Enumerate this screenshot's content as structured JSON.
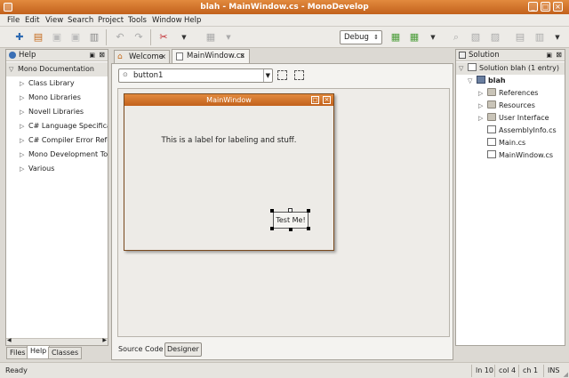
{
  "window": {
    "title": "blah - MainWindow.cs - MonoDevelop"
  },
  "menu": [
    "File",
    "Edit",
    "View",
    "Search",
    "Project",
    "Tools",
    "Window",
    "Help"
  ],
  "toolbar": {
    "config": "Debug"
  },
  "help_panel": {
    "title": "Help",
    "root": "Mono Documentation",
    "items": [
      "Class Library",
      "Mono Libraries",
      "Novell Libraries",
      "C# Language Specifica",
      "C# Compiler Error Refe",
      "Mono Development Too",
      "Various"
    ],
    "tabs": [
      "Files",
      "Help",
      "Classes"
    ]
  },
  "doc_tabs": [
    "Welcome",
    "MainWindow.cs"
  ],
  "designer": {
    "widget_select": "button1",
    "form_title": "MainWindow",
    "label_text": "This is a label for labeling and stuff.",
    "button_text": "Test Me!",
    "view_tabs": [
      "Source Code",
      "Designer"
    ]
  },
  "solution_panel": {
    "title": "Solution",
    "root": "Solution blah (1 entry)",
    "project": "blah",
    "items": [
      {
        "label": "References",
        "kind": "folder"
      },
      {
        "label": "Resources",
        "kind": "folder"
      },
      {
        "label": "User Interface",
        "kind": "folder"
      },
      {
        "label": "AssemblyInfo.cs",
        "kind": "file"
      },
      {
        "label": "Main.cs",
        "kind": "file"
      },
      {
        "label": "MainWindow.cs",
        "kind": "file"
      }
    ]
  },
  "status": {
    "text": "Ready",
    "line": "ln 10",
    "col": "col 4",
    "ch": "ch 1",
    "mode": "INS"
  }
}
